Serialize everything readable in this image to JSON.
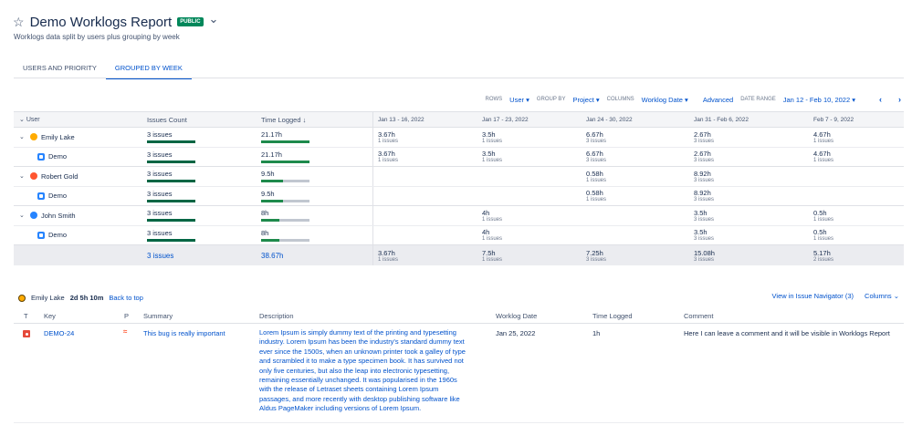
{
  "header": {
    "title": "Demo Worklogs Report",
    "badge": "PUBLIC",
    "subtitle": "Worklogs data split by users plus grouping by week",
    "star_icon": "☆",
    "dropdown_icon": "⌄"
  },
  "tabs": [
    {
      "label": "USERS AND PRIORITY",
      "active": false
    },
    {
      "label": "GROUPED BY WEEK",
      "active": true
    }
  ],
  "toolbar": {
    "rows_label": "ROWS",
    "rows_value": "User",
    "group_label": "GROUP BY",
    "group_value": "Project",
    "columns_label": "COLUMNS",
    "columns_value": "Worklog Date",
    "advanced": "Advanced",
    "date_range_label": "DATE RANGE",
    "date_range_value": "Jan 12 - Feb 10, 2022",
    "prev": "‹",
    "next": "›"
  },
  "table": {
    "headers": {
      "user": "User",
      "issues": "Issues Count",
      "time": "Time Logged",
      "weeks": [
        "Jan 13 - 16, 2022",
        "Jan 17 - 23, 2022",
        "Jan 24 - 30, 2022",
        "Jan 31 - Feb 6, 2022",
        "Feb 7 - 9, 2022"
      ]
    },
    "rows": [
      {
        "name": "Emily Lake",
        "type": "user",
        "issues": "3 issues",
        "time": "21.17h",
        "time_pct": 100,
        "weeks": [
          {
            "v": "3.67h",
            "s": "1 issues"
          },
          {
            "v": "3.5h",
            "s": "1 issues"
          },
          {
            "v": "6.67h",
            "s": "3 issues"
          },
          {
            "v": "2.67h",
            "s": "3 issues"
          },
          {
            "v": "4.67h",
            "s": "1 issues"
          }
        ]
      },
      {
        "name": "Demo",
        "type": "project",
        "issues": "3 issues",
        "time": "21.17h",
        "time_pct": 100,
        "weeks": [
          {
            "v": "3.67h",
            "s": "1 issues"
          },
          {
            "v": "3.5h",
            "s": "1 issues"
          },
          {
            "v": "6.67h",
            "s": "3 issues"
          },
          {
            "v": "2.67h",
            "s": "3 issues"
          },
          {
            "v": "4.67h",
            "s": "1 issues"
          }
        ]
      },
      {
        "name": "Robert Gold",
        "type": "user",
        "issues": "3 issues",
        "time": "9.5h",
        "time_pct": 45,
        "weeks": [
          null,
          null,
          {
            "v": "0.58h",
            "s": "1 issues"
          },
          {
            "v": "8.92h",
            "s": "3 issues"
          },
          null
        ]
      },
      {
        "name": "Demo",
        "type": "project",
        "issues": "3 issues",
        "time": "9.5h",
        "time_pct": 45,
        "weeks": [
          null,
          null,
          {
            "v": "0.58h",
            "s": "1 issues"
          },
          {
            "v": "8.92h",
            "s": "3 issues"
          },
          null
        ]
      },
      {
        "name": "John Smith",
        "type": "user",
        "issues": "3 issues",
        "time": "8h",
        "time_pct": 38,
        "weeks": [
          null,
          {
            "v": "4h",
            "s": "1 issues"
          },
          null,
          {
            "v": "3.5h",
            "s": "3 issues"
          },
          {
            "v": "0.5h",
            "s": "1 issues"
          }
        ]
      },
      {
        "name": "Demo",
        "type": "project",
        "issues": "3 issues",
        "time": "8h",
        "time_pct": 38,
        "weeks": [
          null,
          {
            "v": "4h",
            "s": "1 issues"
          },
          null,
          {
            "v": "3.5h",
            "s": "3 issues"
          },
          {
            "v": "0.5h",
            "s": "1 issues"
          }
        ]
      }
    ],
    "total": {
      "issues": "3 issues",
      "time": "38.67h",
      "weeks": [
        {
          "v": "3.67h",
          "s": "1 issues"
        },
        {
          "v": "7.5h",
          "s": "1 issues"
        },
        {
          "v": "7.25h",
          "s": "3 issues"
        },
        {
          "v": "15.08h",
          "s": "3 issues"
        },
        {
          "v": "5.17h",
          "s": "2 issues"
        }
      ]
    }
  },
  "detail": {
    "user": "Emily Lake",
    "duration": "2d 5h 10m",
    "back": "Back to top",
    "navigator": "View in Issue Navigator (3)",
    "columns": "Columns",
    "headers": {
      "t": "T",
      "key": "Key",
      "p": "P",
      "summary": "Summary",
      "description": "Description",
      "date": "Worklog Date",
      "time": "Time Logged",
      "comment": "Comment"
    },
    "row": {
      "key": "DEMO-24",
      "summary": "This bug is really important",
      "description": "Lorem Ipsum is simply dummy text of the printing and typesetting industry. Lorem Ipsum has been the industry's standard dummy text ever since the 1500s, when an unknown printer took a galley of type and scrambled it to make a type specimen book. It has survived not only five centuries, but also the leap into electronic typesetting, remaining essentially unchanged. It was popularised in the 1960s with the release of Letraset sheets containing Lorem Ipsum passages, and more recently with desktop publishing software like Aldus PageMaker including versions of Lorem Ipsum.",
      "date": "Jan 25, 2022",
      "time": "1h",
      "comment": "Here I can leave a comment and it will be visible in Worklogs Report"
    }
  },
  "colors": {
    "link": "#0052cc",
    "bar": "#1e8a4c",
    "badge": "#00875a"
  }
}
